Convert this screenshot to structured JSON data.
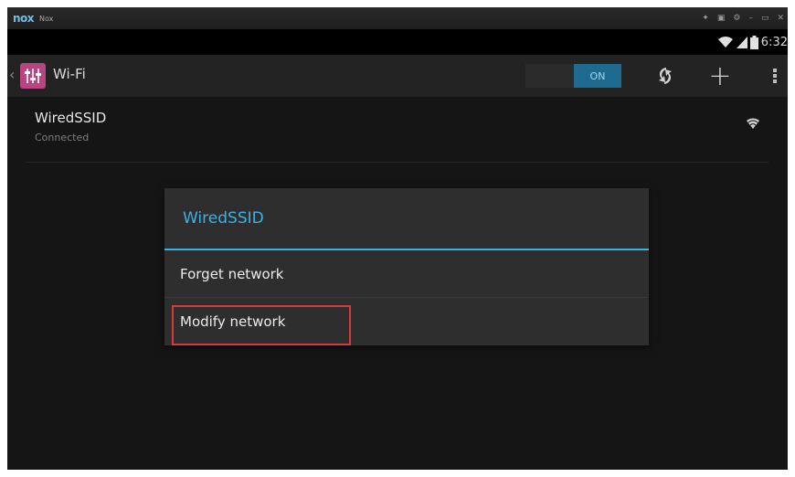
{
  "window": {
    "logo": "nox",
    "title": "Nox",
    "controls": [
      "✦",
      "▣",
      "⚙",
      "–",
      "▭",
      "✕"
    ]
  },
  "statusbar": {
    "time": "6:32",
    "icons": [
      "wifi-icon",
      "signal-icon",
      "battery-icon"
    ]
  },
  "actionbar": {
    "title": "Wi-Fi",
    "toggle_label": "ON",
    "icons": [
      "wps-icon",
      "add-network-icon",
      "overflow-menu-icon"
    ]
  },
  "networks": [
    {
      "name": "WiredSSID",
      "status": "Connected"
    }
  ],
  "dialog": {
    "title": "WiredSSID",
    "items": [
      "Forget network",
      "Modify network"
    ],
    "accent_color": "#33b5e5",
    "highlight_color": "#d63b3b"
  }
}
